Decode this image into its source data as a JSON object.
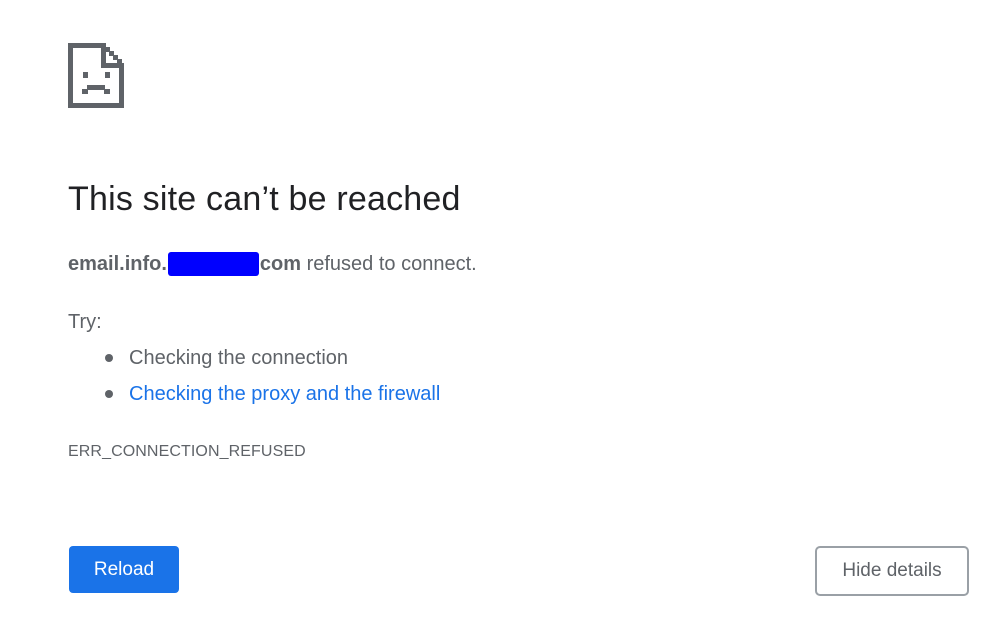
{
  "colors": {
    "title": "#202124",
    "text": "#5f6368",
    "link": "#1a73e8",
    "primary_button": "#1a73e8",
    "redaction": "#0000ff"
  },
  "icon": {
    "name": "sad-page-icon"
  },
  "title": "This site can’t be reached",
  "summary": {
    "host_prefix": "email.info.",
    "host_suffix": "com",
    "message": " refused to connect."
  },
  "try_label": "Try:",
  "suggestions": [
    {
      "label": "Checking the connection",
      "is_link": false
    },
    {
      "label": "Checking the proxy and the firewall",
      "is_link": true
    }
  ],
  "error_code": "ERR_CONNECTION_REFUSED",
  "buttons": {
    "reload": "Reload",
    "hide_details": "Hide details"
  }
}
